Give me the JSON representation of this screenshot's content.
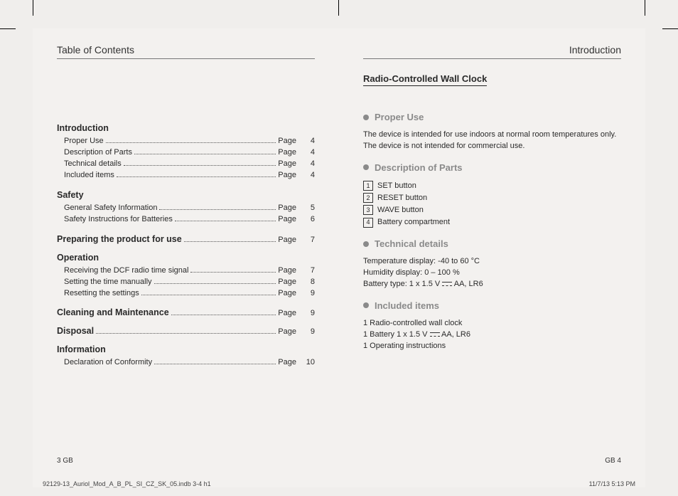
{
  "header": {
    "left_title": "Table of Contents",
    "right_title": "Introduction"
  },
  "toc": {
    "page_label": "Page",
    "sections": [
      {
        "title": "Introduction",
        "items": [
          {
            "label": "Proper Use",
            "page": "4"
          },
          {
            "label": "Description of Parts",
            "page": "4"
          },
          {
            "label": "Technical details",
            "page": "4"
          },
          {
            "label": "Included items",
            "page": "4"
          }
        ]
      },
      {
        "title": "Safety",
        "items": [
          {
            "label": "General Safety Information",
            "page": "5"
          },
          {
            "label": "Safety Instructions for Batteries",
            "page": "6"
          }
        ]
      },
      {
        "title": "Preparing the product for use",
        "title_page": "7",
        "items": []
      },
      {
        "title": "Operation",
        "items": [
          {
            "label": "Receiving the DCF radio time signal",
            "page": "7"
          },
          {
            "label": "Setting the time manually",
            "page": "8"
          },
          {
            "label": "Resetting the settings",
            "page": "9"
          }
        ]
      },
      {
        "title": "Cleaning and Maintenance",
        "title_page": "9",
        "items": []
      },
      {
        "title": "Disposal",
        "title_page": "9",
        "items": []
      },
      {
        "title": "Information",
        "items": [
          {
            "label": "Declaration of Conformity",
            "page": "10"
          }
        ]
      }
    ]
  },
  "right": {
    "title": "Radio-Controlled Wall Clock",
    "sections": {
      "proper_use": {
        "heading": "Proper Use",
        "text": "The device is intended for use indoors at normal room temperatures only. The device is not intended for commercial use."
      },
      "parts": {
        "heading": "Description of Parts",
        "items": [
          {
            "num": "1",
            "label": "SET button"
          },
          {
            "num": "2",
            "label": "RESET button"
          },
          {
            "num": "3",
            "label": "WAVE button"
          },
          {
            "num": "4",
            "label": "Battery compartment"
          }
        ]
      },
      "tech": {
        "heading": "Technical details",
        "lines": [
          "Temperature display: -40 to 60 °C",
          "Humidity display: 0 – 100 %",
          "Battery type: 1 x 1.5 V ⎓ AA, LR6"
        ],
        "battery_prefix": "Battery type: 1 x 1.5 V ",
        "battery_suffix": " AA, LR6"
      },
      "included": {
        "heading": "Included items",
        "lines_prefix1": "1 Radio-controlled wall clock",
        "battery_prefix": "1 Battery 1 x 1.5 V ",
        "battery_suffix": " AA, LR6",
        "lines_suffix1": "1 Operating instructions"
      }
    }
  },
  "folio": {
    "left": "3   GB",
    "right": "GB   4"
  },
  "imprint": {
    "file": "92129-13_Auriol_Mod_A_B_PL_SI_CZ_SK_05.indb   3-4  h1",
    "datetime": "11/7/13   5:13 PM"
  }
}
